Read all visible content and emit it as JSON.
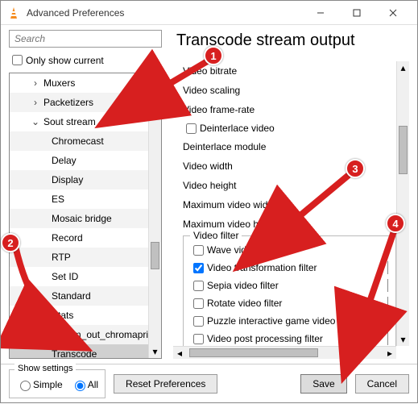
{
  "window": {
    "title": "Advanced Preferences"
  },
  "left": {
    "search_placeholder": "Search",
    "only_current_label": "Only show current",
    "tree": [
      {
        "label": "Muxers",
        "caret": ">",
        "level": 1
      },
      {
        "label": "Packetizers",
        "caret": ">",
        "level": 1
      },
      {
        "label": "Sout stream",
        "caret": "v",
        "level": 1
      },
      {
        "label": "Chromecast",
        "level": 2
      },
      {
        "label": "Delay",
        "level": 2
      },
      {
        "label": "Display",
        "level": 2
      },
      {
        "label": "ES",
        "level": 2
      },
      {
        "label": "Mosaic bridge",
        "level": 2
      },
      {
        "label": "Record",
        "level": 2
      },
      {
        "label": "RTP",
        "level": 2
      },
      {
        "label": "Set ID",
        "level": 2
      },
      {
        "label": "Standard",
        "level": 2
      },
      {
        "label": "Stats",
        "level": 2
      },
      {
        "label": "stream_out_chromaprint",
        "level": 2
      },
      {
        "label": "Transcode",
        "level": 2,
        "selected": true
      }
    ]
  },
  "right": {
    "title": "Transcode stream output",
    "rows": [
      {
        "type": "label",
        "text": "Video bitrate"
      },
      {
        "type": "label",
        "text": "Video scaling"
      },
      {
        "type": "label",
        "text": "Video frame-rate"
      },
      {
        "type": "check",
        "text": "Deinterlace video",
        "checked": false
      },
      {
        "type": "label",
        "text": "Deinterlace module"
      },
      {
        "type": "label",
        "text": "Video width"
      },
      {
        "type": "label",
        "text": "Video height"
      },
      {
        "type": "label",
        "text": "Maximum video width"
      },
      {
        "type": "label",
        "text": "Maximum video height"
      }
    ],
    "fieldset_legend": "Video filter",
    "filters": [
      {
        "text": "Wave video filter",
        "checked": false
      },
      {
        "text": "Video transformation filter",
        "checked": true
      },
      {
        "text": "Sepia video filter",
        "checked": false
      },
      {
        "text": "Rotate video filter",
        "checked": false
      },
      {
        "text": "Puzzle interactive game video filter",
        "checked": false
      },
      {
        "text": "Video post processing filter",
        "checked": false
      }
    ]
  },
  "bottom": {
    "show_settings_legend": "Show settings",
    "radio_simple": "Simple",
    "radio_all": "All",
    "reset_label": "Reset Preferences",
    "save_label": "Save",
    "cancel_label": "Cancel"
  },
  "callouts": {
    "c1": "1",
    "c2": "2",
    "c3": "3",
    "c4": "4"
  }
}
